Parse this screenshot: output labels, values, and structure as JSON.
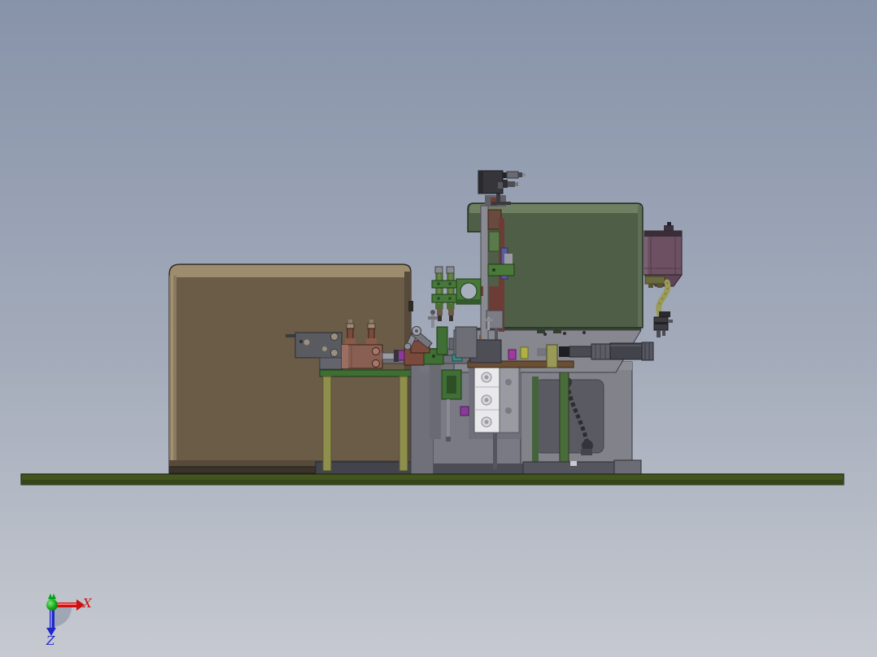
{
  "viewport": {
    "background_top": "#8793a9",
    "background_mid": "#a4acbb",
    "background_bottom": "#c6c9d0"
  },
  "triad": {
    "x_label": "X",
    "z_label": "Z",
    "x_axis_color": "#cc1111",
    "y_axis_color": "#00a318",
    "z_axis_color": "#2026c8"
  },
  "palette": {
    "base_plate": "#44541f",
    "base_plate_edge": "#36451a",
    "hopper_body": "#6a5c47",
    "hopper_top": "#9d8c6d",
    "housing_body": "#4f5f47",
    "housing_top": "#6f7f62",
    "motor_body": "#6d5162",
    "motor_band": "#3a2d38",
    "cable": "#9b9b58",
    "frame_gray": "#82828a",
    "table_rail_green": "#3e6e32",
    "table_leg_olive": "#8f8f4d",
    "support_post_green": "#4a6b3a",
    "cylinder_body": "#8a5f53",
    "fitting_brown": "#7a4a3c",
    "shock_body": "#5d7c3f",
    "bracket_green": "#47783a",
    "carriage_white": "#e9e9ec",
    "sensor_body": "#35353a",
    "shaft_metal": "#43434b",
    "rail_brown": "#6b4f35",
    "accent_purple": "#8a3a9a",
    "accent_magenta": "#a03aa0",
    "accent_teal": "#3a8a8a",
    "accent_yellow": "#b0b043"
  },
  "components": [
    "base-plate",
    "hopper-box",
    "table-frame",
    "support-frame",
    "pulley-belt",
    "machine-platform",
    "gearbox-housing",
    "vertical-slide",
    "sensor-head",
    "stepper-motor",
    "motor-cable",
    "linear-carriage",
    "pneumatic-cylinder",
    "air-fittings",
    "mounting-plate",
    "toggle-clamp",
    "shock-absorbers",
    "clamp-bracket",
    "drive-shaft",
    "orientation-triad"
  ]
}
